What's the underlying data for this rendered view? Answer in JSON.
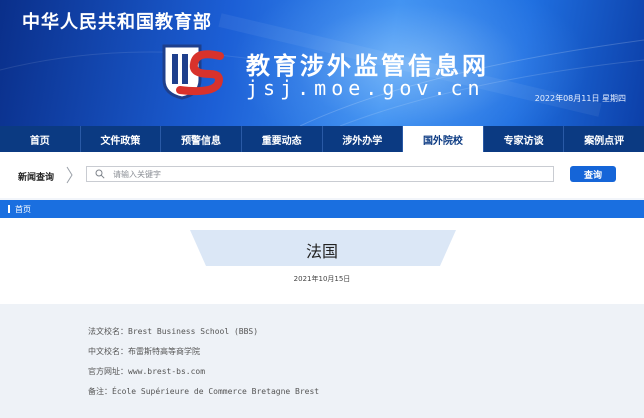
{
  "header": {
    "ministry": "中华人民共和国教育部",
    "site_title": "教育涉外监管信息网",
    "site_domain": "jsj.moe.gov.cn",
    "date_line": "2022年08月11日  星期四"
  },
  "logo": {
    "icon": "jsj-logo-icon",
    "colors": {
      "blue": "#1e3f8c",
      "red": "#d8322c"
    }
  },
  "nav": {
    "items": [
      {
        "label": "首页"
      },
      {
        "label": "文件政策"
      },
      {
        "label": "预警信息"
      },
      {
        "label": "重要动态"
      },
      {
        "label": "涉外办学"
      },
      {
        "label": "国外院校"
      },
      {
        "label": "专家访谈"
      },
      {
        "label": "案例点评"
      }
    ],
    "active": "国外院校"
  },
  "search": {
    "label": "新闻查询",
    "placeholder": "请输入关键字",
    "button": "查询"
  },
  "breadcrumb": {
    "home": "首页"
  },
  "article": {
    "title": "法国",
    "date": "2021年10月15日"
  },
  "details": [
    "法文校名：Brest Business School (BBS)",
    "中文校名：布雷斯特高等商学院",
    "官方网址：www.brest-bs.com",
    "备注：École Supérieure de Commerce Bretagne Brest"
  ],
  "colors": {
    "banner": "#1c5fd6",
    "nav": "#0b3a82",
    "accent": "#1565d8",
    "breadcrumb": "#1a6fe0"
  }
}
